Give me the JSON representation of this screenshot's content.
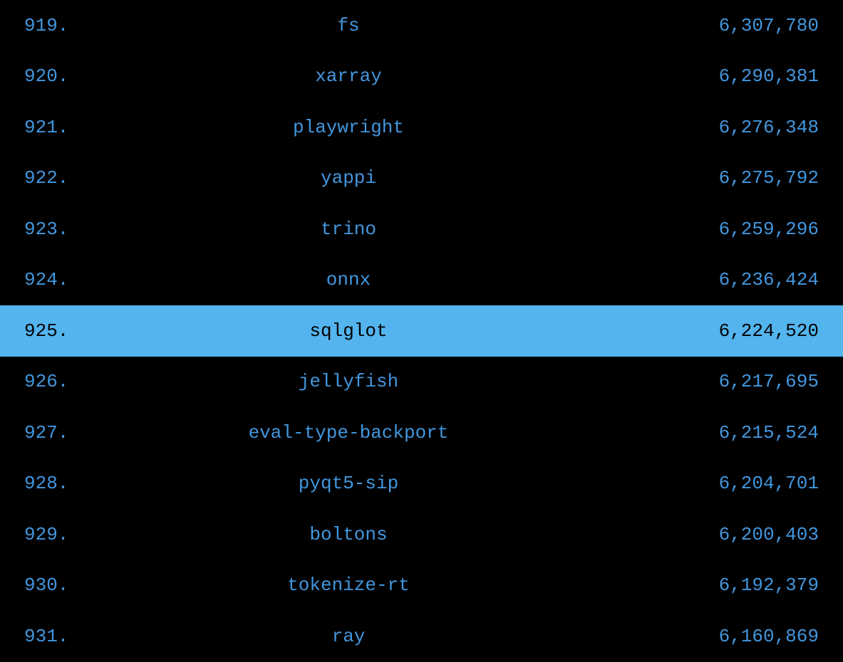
{
  "rows": [
    {
      "rank": "919.",
      "name": "fs",
      "downloads": "6,307,780",
      "selected": false
    },
    {
      "rank": "920.",
      "name": "xarray",
      "downloads": "6,290,381",
      "selected": false
    },
    {
      "rank": "921.",
      "name": "playwright",
      "downloads": "6,276,348",
      "selected": false
    },
    {
      "rank": "922.",
      "name": "yappi",
      "downloads": "6,275,792",
      "selected": false
    },
    {
      "rank": "923.",
      "name": "trino",
      "downloads": "6,259,296",
      "selected": false
    },
    {
      "rank": "924.",
      "name": "onnx",
      "downloads": "6,236,424",
      "selected": false
    },
    {
      "rank": "925.",
      "name": "sqlglot",
      "downloads": "6,224,520",
      "selected": true
    },
    {
      "rank": "926.",
      "name": "jellyfish",
      "downloads": "6,217,695",
      "selected": false
    },
    {
      "rank": "927.",
      "name": "eval-type-backport",
      "downloads": "6,215,524",
      "selected": false
    },
    {
      "rank": "928.",
      "name": "pyqt5-sip",
      "downloads": "6,204,701",
      "selected": false
    },
    {
      "rank": "929.",
      "name": "boltons",
      "downloads": "6,200,403",
      "selected": false
    },
    {
      "rank": "930.",
      "name": "tokenize-rt",
      "downloads": "6,192,379",
      "selected": false
    },
    {
      "rank": "931.",
      "name": "ray",
      "downloads": "6,160,869",
      "selected": false
    }
  ]
}
